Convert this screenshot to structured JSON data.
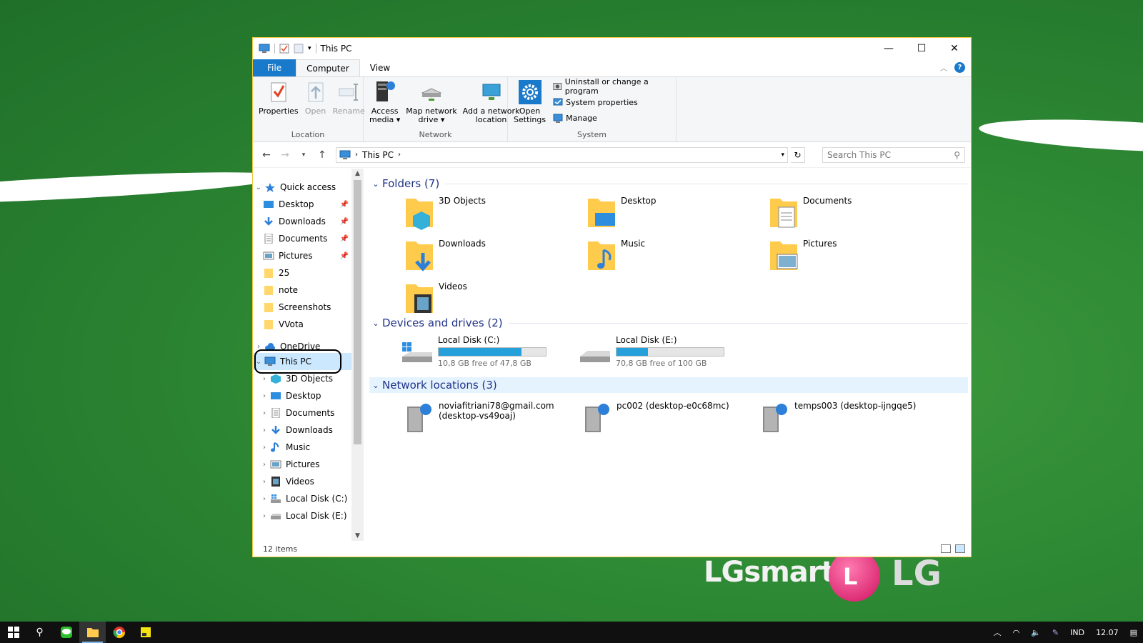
{
  "window": {
    "title": "This PC",
    "tabs": [
      "File",
      "Computer",
      "View"
    ],
    "active_tab": "Computer"
  },
  "ribbon": {
    "location": {
      "label": "Location",
      "buttons": [
        {
          "label": "Properties",
          "enabled": true
        },
        {
          "label": "Open",
          "enabled": false
        },
        {
          "label": "Rename",
          "enabled": false
        }
      ]
    },
    "network": {
      "label": "Network",
      "buttons": [
        {
          "label": "Access\nmedia ▾"
        },
        {
          "label": "Map network\ndrive ▾"
        },
        {
          "label": "Add a network\nlocation"
        }
      ]
    },
    "system": {
      "label": "System",
      "open_settings": "Open\nSettings",
      "items": [
        "Uninstall or change a program",
        "System properties",
        "Manage"
      ]
    }
  },
  "address": {
    "path": "This PC",
    "search_placeholder": "Search This PC"
  },
  "nav": {
    "quick_access": "Quick access",
    "quick_items": [
      "Desktop",
      "Downloads",
      "Documents",
      "Pictures",
      "25",
      "note",
      "Screenshots",
      "VVota"
    ],
    "onedrive": "OneDrive",
    "this_pc": "This PC",
    "this_pc_items": [
      "3D Objects",
      "Desktop",
      "Documents",
      "Downloads",
      "Music",
      "Pictures",
      "Videos",
      "Local Disk (C:)",
      "Local Disk (E:)"
    ]
  },
  "main": {
    "folders_header": "Folders (7)",
    "folders": [
      "3D Objects",
      "Desktop",
      "Documents",
      "Downloads",
      "Music",
      "Pictures",
      "Videos"
    ],
    "drives_header": "Devices and drives (2)",
    "drives": [
      {
        "name": "Local Disk (C:)",
        "free": "10,8 GB free of 47,8 GB",
        "used_fraction": 0.77
      },
      {
        "name": "Local Disk (E:)",
        "free": "70,8 GB free of 100 GB",
        "used_fraction": 0.29
      }
    ],
    "network_header": "Network locations (3)",
    "network": [
      {
        "line1": "noviafitriani78@gmail.com",
        "line2": "(desktop-vs49oaj)"
      },
      {
        "line1": "pc002 (desktop-e0c68mc)",
        "line2": ""
      },
      {
        "line1": "temps003 (desktop-ijngqe5)",
        "line2": ""
      }
    ]
  },
  "status": {
    "items": "12 items"
  },
  "taskbar": {
    "language": "IND",
    "time": "12.07"
  },
  "wallpaper": {
    "brand1": "LGsmart",
    "brand2": "LG"
  },
  "colors": {
    "accent": "#1979ca",
    "selection": "#cce8ff",
    "bar_fill": "#26a0da"
  }
}
